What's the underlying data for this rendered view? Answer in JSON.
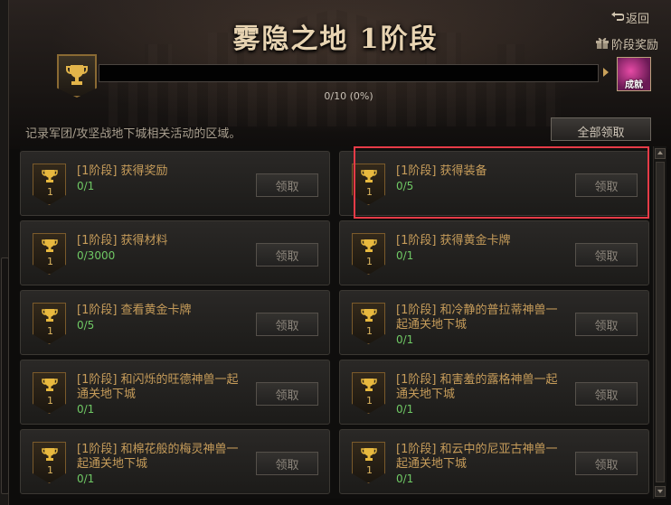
{
  "header": {
    "title": "雾隐之地 1阶段",
    "return_label": "返回",
    "stage_reward_label": "阶段奖励",
    "achievement_icon_text": "成就"
  },
  "progress": {
    "text": "0/10 (0%)",
    "fraction": 0
  },
  "description": "记录军团/攻坚战地下城相关活动的区域。",
  "claim_all_label": "全部领取",
  "colors": {
    "gold": "#c69c5a",
    "count_green": "#6fc864",
    "highlight_red": "#e53b47"
  },
  "achievements": [
    {
      "badge": "1",
      "name": "[1阶段] 获得奖励",
      "count": "0/1",
      "claim": "领取"
    },
    {
      "badge": "1",
      "name": "[1阶段] 获得装备",
      "count": "0/5",
      "claim": "领取"
    },
    {
      "badge": "1",
      "name": "[1阶段] 获得材料",
      "count": "0/3000",
      "claim": "领取"
    },
    {
      "badge": "1",
      "name": "[1阶段] 获得黄金卡牌",
      "count": "0/1",
      "claim": "领取"
    },
    {
      "badge": "1",
      "name": "[1阶段] 查看黄金卡牌",
      "count": "0/5",
      "claim": "领取"
    },
    {
      "badge": "1",
      "name": "[1阶段] 和冷静的普拉蒂神兽一起通关地下城",
      "count": "0/1",
      "claim": "领取"
    },
    {
      "badge": "1",
      "name": "[1阶段] 和闪烁的旺德神兽一起通关地下城",
      "count": "0/1",
      "claim": "领取"
    },
    {
      "badge": "1",
      "name": "[1阶段] 和害羞的露格神兽一起通关地下城",
      "count": "0/1",
      "claim": "领取"
    },
    {
      "badge": "1",
      "name": "[1阶段] 和棉花般的梅灵神兽一起通关地下城",
      "count": "0/1",
      "claim": "领取"
    },
    {
      "badge": "1",
      "name": "[1阶段] 和云中的尼亚古神兽一起通关地下城",
      "count": "0/1",
      "claim": "领取"
    }
  ]
}
